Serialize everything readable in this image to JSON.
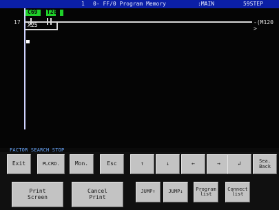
{
  "header": {
    "index": "1",
    "title": "0- FF/0 Program Memory",
    "module": ":MAIN",
    "step": "59STEP"
  },
  "ladder": {
    "row_number": "17",
    "contact_1": "C69",
    "contact_2": "T28",
    "branch_device": "X25",
    "coil": "-(M120 >"
  },
  "status": {
    "text": "FACTOR SEARCH STOP"
  },
  "keys_row1": [
    "Exit",
    "PLCRD.",
    "Mon.",
    "Esc",
    "↑",
    "↓",
    "←",
    "→",
    "↲",
    "Sea.\nBack"
  ],
  "keys_row2": {
    "print_screen": "Print\nScreen",
    "cancel_print": "Cancel\nPrint",
    "jump_up": "JUMP↑",
    "jump_down": "JUMP↓",
    "program_list": "Program\nlist",
    "connect_list": "Connect\nlist"
  },
  "colors": {
    "title_bar": "#0b1fa6",
    "contact_highlight": "#1fd12a",
    "status_text": "#6aa8ff",
    "button_face": "#c3c3c3"
  }
}
